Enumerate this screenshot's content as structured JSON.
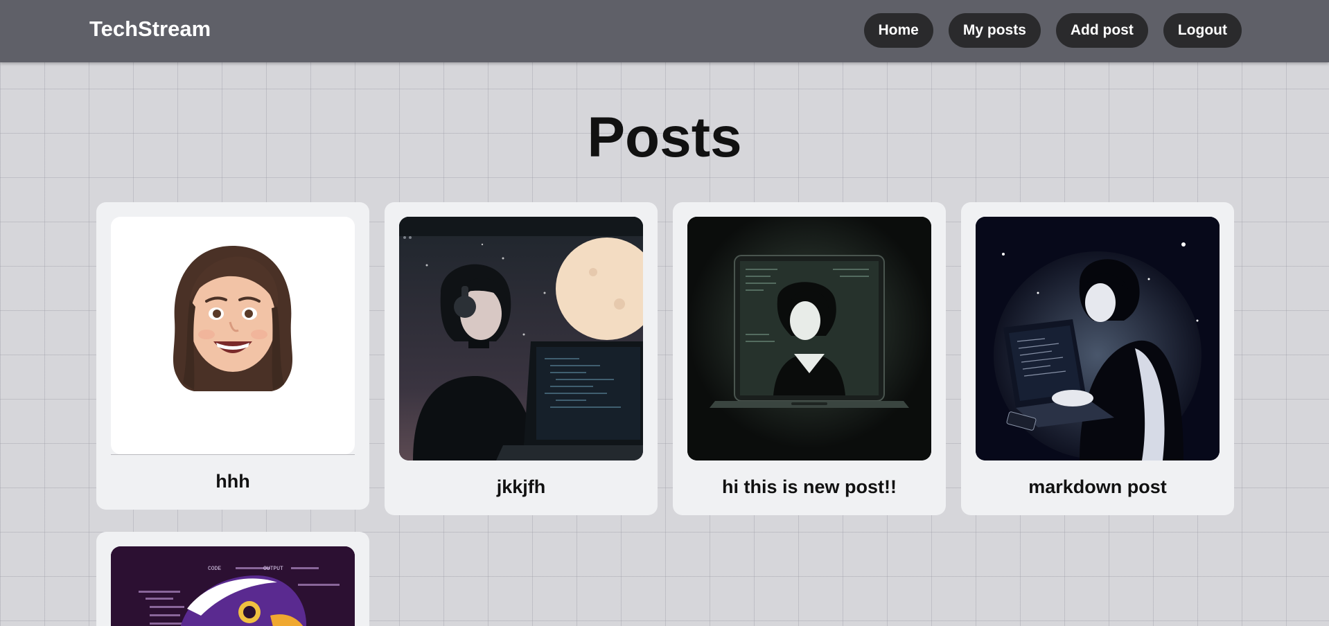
{
  "navbar": {
    "brand": "TechStream",
    "links": [
      "Home",
      "My posts",
      "Add post",
      "Logout"
    ]
  },
  "page_title": "Posts",
  "posts": [
    {
      "title": "hhh",
      "image": "memoji-girl-avatar"
    },
    {
      "title": "jkkjfh",
      "image": "anime-girl-headphones-laptop-moon"
    },
    {
      "title": "hi this is new post!!",
      "image": "laptop-girl-silhouette"
    },
    {
      "title": "markdown post",
      "image": "girl-coding-laptop-night"
    },
    {
      "title": "",
      "image": "purple-eagle-code"
    }
  ],
  "colors": {
    "navbar_bg": "#5f6068",
    "nav_button_bg": "#2a2a2c",
    "card_bg": "#f0f1f3",
    "page_bg": "#d6d6da"
  }
}
